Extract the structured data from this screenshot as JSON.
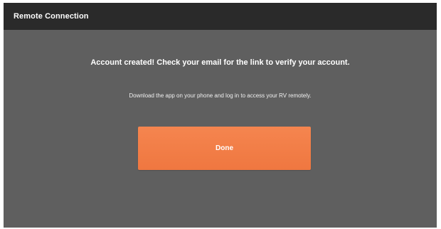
{
  "header": {
    "title": "Remote Connection"
  },
  "main": {
    "message": "Account created! Check your email for the link to verify your account.",
    "submessage": "Download the app on your phone and log in to access your RV remotely.",
    "done_label": "Done"
  },
  "colors": {
    "header_bg": "#2a2a2a",
    "panel_bg": "#5f5f5f",
    "accent": "#f17a45"
  }
}
